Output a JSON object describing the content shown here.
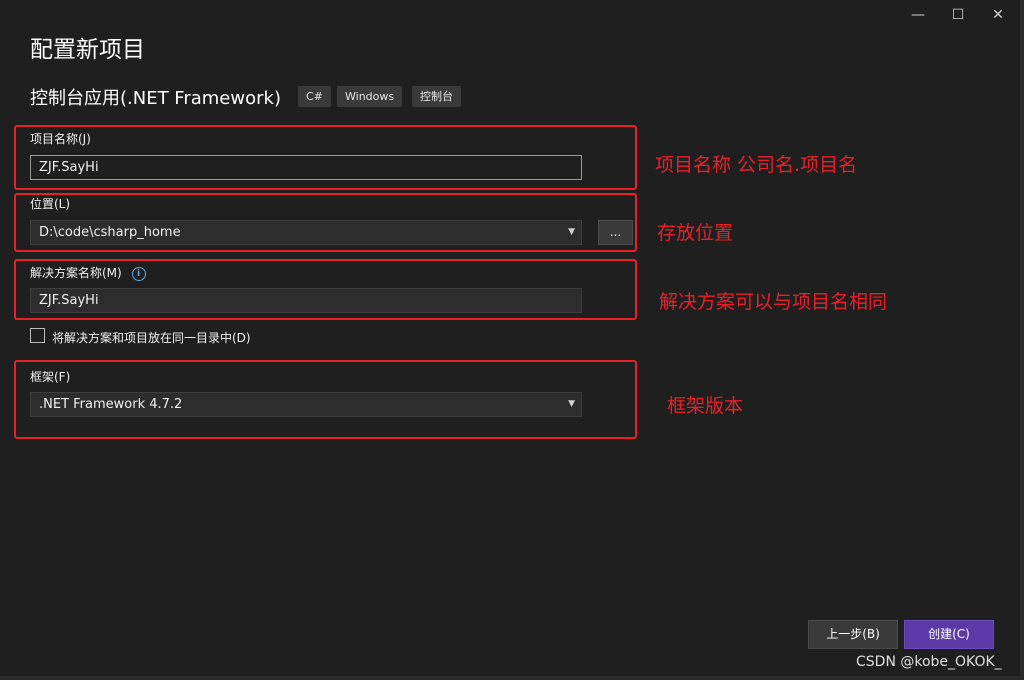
{
  "window": {
    "minimize": "—",
    "maximize": "☐",
    "close": "✕"
  },
  "header": {
    "title": "配置新项目",
    "template_name": "控制台应用(.NET Framework)",
    "tags": [
      "C#",
      "Windows",
      "控制台"
    ]
  },
  "form": {
    "project_name": {
      "label": "项目名称(J)",
      "value": "ZJF.SayHi"
    },
    "location": {
      "label": "位置(L)",
      "value": "D:\\code\\csharp_home",
      "browse_label": "..."
    },
    "solution_name": {
      "label": "解决方案名称(M)",
      "value": "ZJF.SayHi"
    },
    "same_dir_checkbox": {
      "label": "将解决方案和项目放在同一目录中(D)",
      "checked": false
    },
    "framework": {
      "label": "框架(F)",
      "value": ".NET Framework 4.7.2"
    }
  },
  "annotations": {
    "project_name": "项目名称 公司名.项目名",
    "location": "存放位置",
    "solution_name": "解决方案可以与项目名相同",
    "framework": "框架版本"
  },
  "footer": {
    "back_label": "上一步(B)",
    "create_label": "创建(C)"
  },
  "watermark": "CSDN @kobe_OKOK_",
  "colors": {
    "annotation_red": "#e8202a",
    "create_button": "#5b3aa8",
    "background": "#1f1f1f"
  }
}
